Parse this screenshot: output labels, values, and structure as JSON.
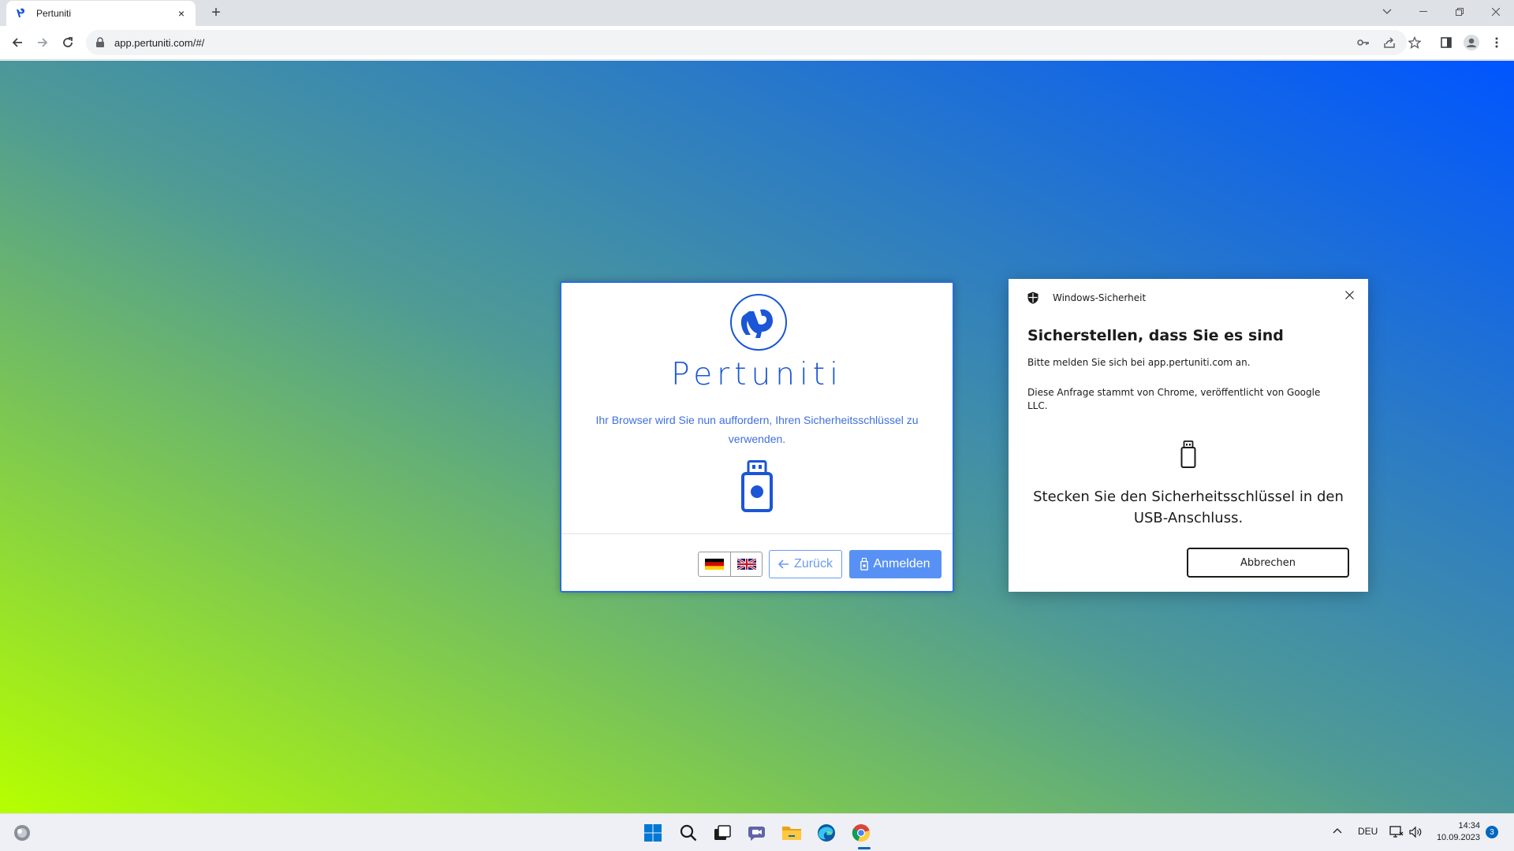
{
  "browser": {
    "tab_title": "Pertuniti",
    "tab_close": "×",
    "new_tab": "+",
    "url": "app.pertuniti.com/#/"
  },
  "login": {
    "brand": "Pertuniti",
    "message": "Ihr Browser wird Sie nun auffordern, Ihren Sicherheitsschlüssel zu verwenden.",
    "back_label": "Zurück",
    "login_label": "Anmelden",
    "languages": [
      "de",
      "en"
    ]
  },
  "windows_security": {
    "app_name": "Windows-Sicherheit",
    "title": "Sicherstellen, dass Sie es sind",
    "line1": "Bitte melden Sie sich bei app.pertuniti.com an.",
    "line2": "Diese Anfrage stammt von Chrome, veröffentlicht von Google LLC.",
    "instruction": "Stecken Sie den Sicherheitsschlüssel in den USB-Anschluss.",
    "cancel_label": "Abbrechen"
  },
  "taskbar": {
    "language": "DEU",
    "time": "14:34",
    "date": "10.09.2023",
    "notification_count": "3"
  },
  "colors": {
    "brand": "#1a56d6",
    "primary_button": "#5891f5",
    "gradient_start": "#b6ff00",
    "gradient_end": "#0055ff"
  }
}
